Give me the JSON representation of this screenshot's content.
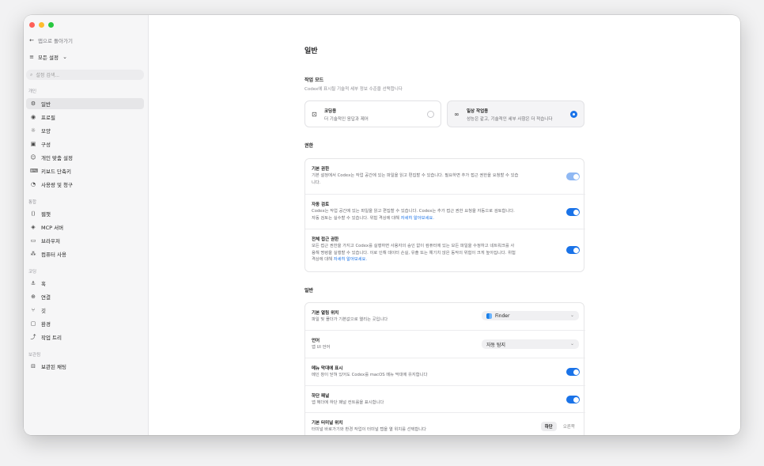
{
  "window": {
    "traffic_lights": [
      "close",
      "minimize",
      "zoom"
    ]
  },
  "sidebar": {
    "back_label": "앱으로 돌아가기",
    "scope_label": "모든 설정",
    "search_placeholder": "설정 검색...",
    "sections": {
      "personal": "개인",
      "integrations": "통합",
      "coding": "코딩",
      "archived": "보관됨"
    },
    "personal_items": [
      {
        "label": "일반",
        "icon": "gear-icon"
      },
      {
        "label": "프로필",
        "icon": "profile-icon"
      },
      {
        "label": "모양",
        "icon": "sun-icon"
      },
      {
        "label": "구성",
        "icon": "config-icon"
      },
      {
        "label": "개인 맞춤 설정",
        "icon": "personalize-icon"
      },
      {
        "label": "키보드 단축키",
        "icon": "keyboard-icon"
      },
      {
        "label": "사용량 및 청구",
        "icon": "gauge-icon"
      }
    ],
    "integration_items": [
      {
        "label": "웹챗",
        "icon": "bracket-icon"
      },
      {
        "label": "MCP 서버",
        "icon": "mcp-icon"
      },
      {
        "label": "브라우저",
        "icon": "browser-icon"
      },
      {
        "label": "컴퓨터 사용",
        "icon": "cursor-icon"
      }
    ],
    "coding_items": [
      {
        "label": "훅",
        "icon": "hook-icon"
      },
      {
        "label": "연결",
        "icon": "globe-icon"
      },
      {
        "label": "깃",
        "icon": "branch-icon"
      },
      {
        "label": "환경",
        "icon": "monitor-icon"
      },
      {
        "label": "작업 트리",
        "icon": "worktree-icon"
      }
    ],
    "archived_items": [
      {
        "label": "보관된 채팅",
        "icon": "archive-icon"
      }
    ]
  },
  "main": {
    "page_title": "일반",
    "work_mode": {
      "title": "작업 모드",
      "subtitle": "Codex에 표시될 기술적 세부 정보 수준을 선택합니다",
      "options": [
        {
          "title": "코딩용",
          "desc": "더 기술적인 응답과 제어",
          "selected": false
        },
        {
          "title": "일상 작업용",
          "desc": "성능은 같고, 기술적인 세부 사항은 더 적습니다",
          "selected": true
        }
      ]
    },
    "permissions": {
      "title": "권한",
      "items": [
        {
          "title": "기본 권한",
          "desc1": "기본 설정에서 Codex는 작업 공간에 있는 파일을 읽고 편집할 수 있습니다. 필요하면 추가 접근 권한을 요청할 수 있습",
          "desc2": "니다.",
          "link": "",
          "enabled": true
        },
        {
          "title": "자동 검토",
          "desc1": "Codex는 작업 공간에 있는 파일을 읽고 편집할 수 있습니다. Codex는 추가 접근 권한 요청을 자동으로 검토합니다.",
          "desc2": "자동 검토는 실수할 수 있습니다. 위험 격상에 대해 ",
          "link": "자세히 알아보세요.",
          "enabled": true
        },
        {
          "title": "전체 접근 권한",
          "desc1": "모든 접근 권한을 가지고 Codex를 실행하면 사용자의 승인 없이 컴퓨터에 있는 모든 파일을 수정하고 네트워크를 사",
          "desc2": "용해 명령을 실행할 수 있습니다. 이로 인해 데이터 손실, 유출 또는 예기치 않은 동작의 위험이 크게 높아집니다. 위험",
          "desc3": "격상에 대해 ",
          "link": "자세히 알아보세요.",
          "enabled": true
        }
      ]
    },
    "general": {
      "title": "일반",
      "open_location": {
        "title": "기본 열림 위치",
        "desc": "파일 및 폴더가 기본값으로 열리는 곳입니다",
        "value": "Finder"
      },
      "language": {
        "title": "언어",
        "desc": "앱 UI 언어",
        "value": "자동 탐지"
      },
      "menubar": {
        "title": "메뉴 막대에 표시",
        "desc": "메인 창이 닫혀 있어도 Codex를 macOS 메뉴 막대에 유지합니다",
        "enabled": true
      },
      "bottom_panel": {
        "title": "하단 패널",
        "desc": "앱 헤더에 하단 패널 컨트롤을 표시합니다",
        "enabled": true
      },
      "terminal_position": {
        "title": "기본 터미널 위치",
        "desc": "터미널 바로가기와 환경 작업이 터미널 탭을 열 위치를 선택합니다",
        "options": [
          "하단",
          "오른쪽"
        ],
        "selected": "하단"
      }
    }
  },
  "colors": {
    "accent": "#1a73e8",
    "sidebar_bg": "#f6f6f7"
  }
}
